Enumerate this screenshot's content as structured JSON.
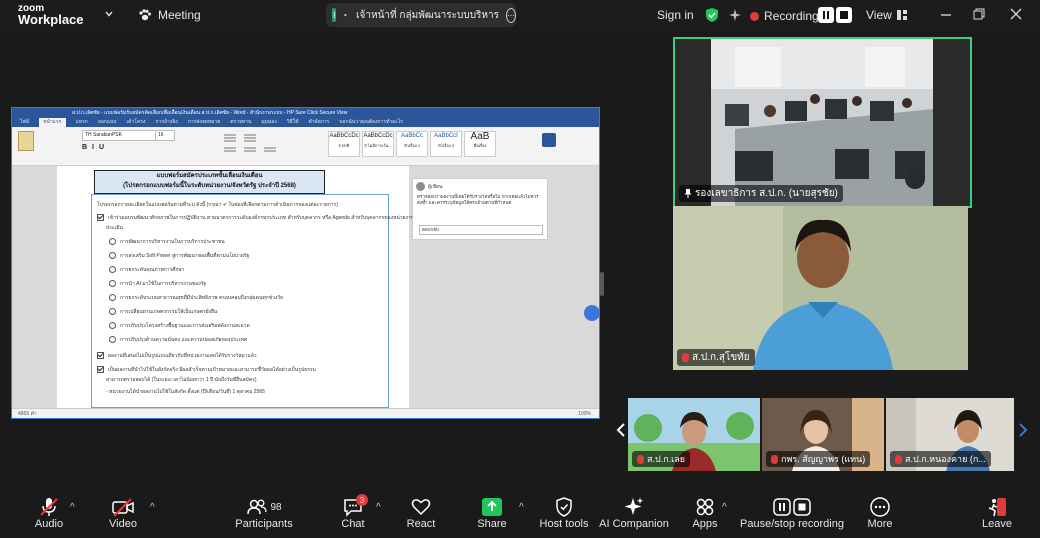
{
  "app": {
    "logo_line1": "zoom",
    "logo_line2": "Workplace",
    "meeting_label": "Meeting"
  },
  "share_banner": {
    "avatar_letter": "I",
    "text": "เจ้าหน้าที่ กลุ่มพัฒนาระบบบริหาร"
  },
  "topbar": {
    "signin": "Sign in",
    "recording": "Recording...",
    "view": "View"
  },
  "shared_doc": {
    "window_title": "ส.ป.ก.เลิศชัย - แบบฟอร์มรับสมัครคัดเลือกเพื่อเลื่อนเงินเดือน ส.ป.ก.เลิศชัย - Word - สำนักงานระบบ - HP Sure Click Secure View",
    "tabs": [
      "ไฟล์",
      "หน้าแรก",
      "แทรก",
      "ออกแบบ",
      "เค้าโครง",
      "การอ้างอิง",
      "การส่งจดหมาย",
      "ตรวจทาน",
      "มุมมอง",
      "วิธีใช้",
      "ตัวจัดการ",
      "บอกฉันว่าคุณต้องการทำอะไร"
    ],
    "font_name": "TH SarabunPSK",
    "font_size": "16",
    "styles": [
      {
        "preview": "AaBbCcDc",
        "name": "¶ ปกติ"
      },
      {
        "preview": "AaBbCcDc",
        "name": "¶ ไม่มีการเว้น..."
      },
      {
        "preview": "AaBbCc",
        "name": "หัวเรื่อง 1"
      },
      {
        "preview": "AaBbCcI",
        "name": "หัวเรื่อง 2"
      },
      {
        "preview": "AaB",
        "name": "ชื่อเรื่อง"
      }
    ],
    "heading1": "แบบฟอร์มสมัครประเภทขั้นเลื่อนเงินเดือน",
    "heading2": "(โปรดกรอกแบบฟอร์มนี้ในระดับหน่วยงาน/จังหวัดรัฐ ประจำปี 2568)",
    "intro": "โปรดกรอกรายละเอียดในแบบฟอร์มตามที่ระบุ ดังนี้ (กรุณา ✔ ในช่องที่เลือกตามการดำเนินการของแต่ละรายการ)",
    "check1": "เข้าร่วมอบรมพัฒนาศักยภาพในการปฏิบัติงาน ตามมาตรการระดับองค์กรทุกประเภท สำหรับบุคลากร หรือ Agenda สำหรับบุคลากรของหน่วยงาน",
    "check1_cont": "ประเมิน",
    "options": [
      "การพัฒนาการบริหารงานในการบริการประชาชน",
      "การส่งเสริม Soft Power สู่การพัฒนาของพื้นที่ตามนโยบายรัฐ",
      "การยกระดับคุณภาพการศึกษา",
      "การนำ AI มาใช้ในการบริหารงานของรัฐ",
      "การยกระดับระบบสาธารณสุขที่มีประสิทธิภาพ ครอบคลุมถึงกลุ่มคนทุกช่วงวัย",
      "การเปลี่ยนผ่านเกษตรกรรมให้เป็นเกษตรยั่งยืน",
      "การปรับปรุงโครงสร้างพื้นฐานและการส่งเสริมพลังงานสะอาด",
      "การปรับปรุงด้านความมั่นคง และความปลอดภัยของประเทศ"
    ],
    "check2": "ผลงานที่เสนอไม่เป็นรูปแบบเดียวกับที่หน่วยงานเคยได้รับรางวัลมาแล้ว",
    "check3": "เป็นผลงานที่นำไปใช้ในสังกัดจริง มีผลสำเร็จตามเป้าหมายและสามารถชี้วัดผลได้อย่างเป็นรูปธรรม",
    "check3_cont": "สามารถตรวจสอบได้ (ในระยะเวลาไม่น้อยกว่า 1 ปี นับถึงวันที่ยื่นสมัคร)",
    "last_line": "- หน่วยงานได้นำผลงานไปใช้ในสังกัด ตั้งแต่ (ปี/เดือน/วันที่) 1 ตุลาคม 2565",
    "comment_author": "ผู้เขียน",
    "comment_text": "ตรวจสอบว่าผลงานนี้เคยได้รับรางวัลหรือไม่ หากเคยแล้วไม่ควรส่งซ้ำ และควรระบุข้อมูลให้ครบถ้วนตามที่กำหนด",
    "comment_reply": "ตอบกลับ",
    "status_left": "4865 คำ",
    "zoom_pct": "100%"
  },
  "participants_video": [
    {
      "name": "รองเลขาธิการ ส.ป.ก. (นายสุรชัย)",
      "pinned": true
    },
    {
      "name": "ส.ป.ก.สุโขทัย",
      "muted": true
    }
  ],
  "gallery": [
    {
      "name": "ส.ป.ก.เลย"
    },
    {
      "name": "กพร. สัญญาพร (แทน)"
    },
    {
      "name": "ส.ป.ก.หนองคาย (ก..."
    }
  ],
  "toolbar": {
    "audio": "Audio",
    "video": "Video",
    "participants": "Participants",
    "participants_count": "98",
    "chat": "Chat",
    "chat_badge": "3",
    "react": "React",
    "share": "Share",
    "host_tools": "Host tools",
    "ai_companion": "AI Companion",
    "apps": "Apps",
    "pause_recording": "Pause/stop recording",
    "more": "More",
    "leave": "Leave"
  },
  "colors": {
    "active_speaker_border": "#3ad07a",
    "share_green": "#21c55d",
    "leave_red": "#e03b3b",
    "word_blue": "#2b579a"
  }
}
